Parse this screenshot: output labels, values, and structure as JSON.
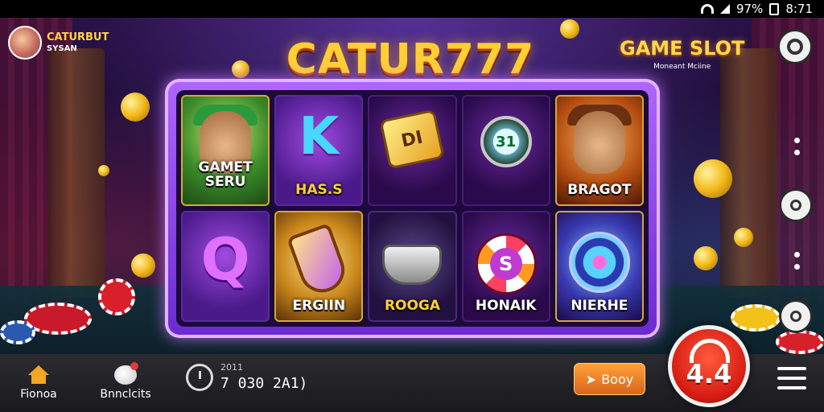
{
  "status_bar": {
    "battery": "97%",
    "time": "8:71"
  },
  "brand": {
    "name": "CATURBUT",
    "sub": "SYSAN"
  },
  "title": "CATUR777",
  "game_slot": {
    "title": "GAME SLOT",
    "subtitle": "Moneant Mciine"
  },
  "reels": [
    {
      "label": "GAMET SERU",
      "symbol": "",
      "style": "green"
    },
    {
      "label": "HAS.S",
      "symbol": "K",
      "style": "purple"
    },
    {
      "label": "",
      "symbol": "DI",
      "style": "dark"
    },
    {
      "label": "",
      "symbol": "31",
      "style": "dark"
    },
    {
      "label": "BRAGOT",
      "symbol": "",
      "style": "orange"
    },
    {
      "label": "",
      "symbol": "Q",
      "style": "purple"
    },
    {
      "label": "ERGIIN",
      "symbol": "",
      "style": "gold"
    },
    {
      "label": "ROOGA",
      "symbol": "",
      "style": "grey"
    },
    {
      "label": "HONAIK",
      "symbol": "S",
      "style": "dark"
    },
    {
      "label": "NIERHE",
      "symbol": "",
      "style": "blue"
    }
  ],
  "nav": {
    "home_label": "Fionoa",
    "promo_label": "Bnnclcits",
    "balance_caption": "2011",
    "balance_value": "7 030 2A1)",
    "body_button": "Booy",
    "spin_value": "4.4"
  },
  "colors": {
    "accent": "#ffcf33",
    "frame": "#b066ff",
    "spin": "#d81e14",
    "button": "#ffa23a"
  }
}
